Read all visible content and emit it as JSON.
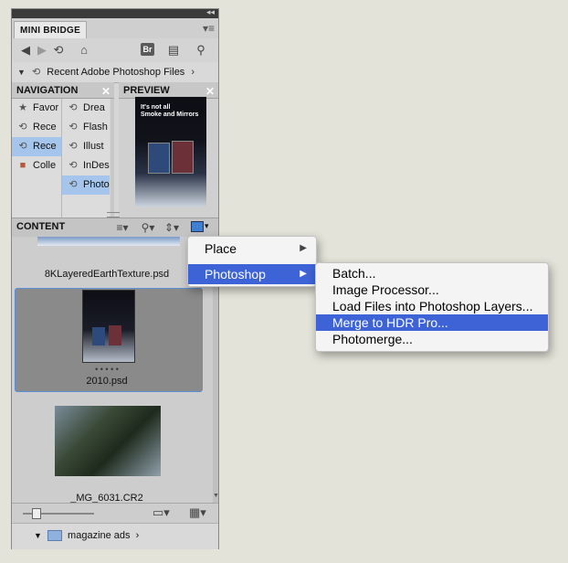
{
  "panel": {
    "tab_label": "MINI BRIDGE",
    "breadcrumb": "Recent Adobe Photoshop Files",
    "navigation_header": "NAVIGATION",
    "preview_header": "PREVIEW",
    "nav_col1": [
      "Favor",
      "Rece",
      "Rece",
      "Colle"
    ],
    "nav_col2": [
      "Drea",
      "Flash",
      "Illust",
      "InDes",
      "Photo"
    ],
    "content_header": "CONTENT",
    "files": [
      "8KLayeredEarthTexture.psd",
      "2010.psd",
      "_MG_6031.CR2"
    ],
    "thumb_dots": "• • • • •",
    "bottom_path": "magazine ads",
    "preview_text_line1": "It's not all",
    "preview_text_line2": "Smoke and Mirrors"
  },
  "context_menu": {
    "items": [
      "Place",
      "Photoshop"
    ]
  },
  "submenu": {
    "items": [
      "Batch...",
      "Image Processor...",
      "Load Files into Photoshop Layers...",
      "Merge to HDR Pro...",
      "Photomerge..."
    ]
  },
  "colors": {
    "highlight": "#3d63d6",
    "selection": "#a6c5ec"
  }
}
